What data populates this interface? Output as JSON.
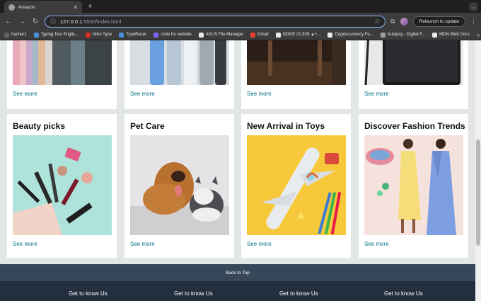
{
  "browser": {
    "tab_title": "Amazon",
    "new_tab": "+",
    "url_host": "127.0.0.1",
    "url_rest": ":5500/index.html",
    "relaunch_label": "Relaunch to update",
    "bookmarks": [
      {
        "label": "hacher1",
        "color": "#5f6368"
      },
      {
        "label": "Typing Test Englis...",
        "color": "#4a90d9"
      },
      {
        "label": "Nitro Type",
        "color": "#d93025"
      },
      {
        "label": "TypeRacer",
        "color": "#4a90d9"
      },
      {
        "label": "code for website",
        "color": "#7b61ff"
      },
      {
        "label": "ASUS File Manager",
        "color": "#e8eaed"
      },
      {
        "label": "Gmail",
        "color": "#ea4335"
      },
      {
        "label": "DOGE 21.928 ▲+...",
        "color": "#e8eaed"
      },
      {
        "label": "Cryptocurrency Fu...",
        "color": "#e8eaed"
      },
      {
        "label": "Autopsy - Digital F...",
        "color": "#9aa0a6"
      },
      {
        "label": "MDN Web Docs",
        "color": "#e8eaed"
      }
    ],
    "bookmarks_more": "»"
  },
  "top_row": [
    {
      "see_more": "See more"
    },
    {
      "see_more": "See more"
    },
    {
      "see_more": "See more"
    },
    {
      "see_more": "See more"
    }
  ],
  "cards": [
    {
      "title": "Beauty picks",
      "see_more": "See more"
    },
    {
      "title": "Pet Care",
      "see_more": "See more"
    },
    {
      "title": "New Arrival in Toys",
      "see_more": "See more"
    },
    {
      "title": "Discover Fashion Trends",
      "see_more": "See more"
    }
  ],
  "back_to_top": "Back to Top",
  "footer": {
    "columns": [
      "Get to know Us",
      "Get to know Us",
      "Get to know Us",
      "Get to know Us"
    ]
  }
}
